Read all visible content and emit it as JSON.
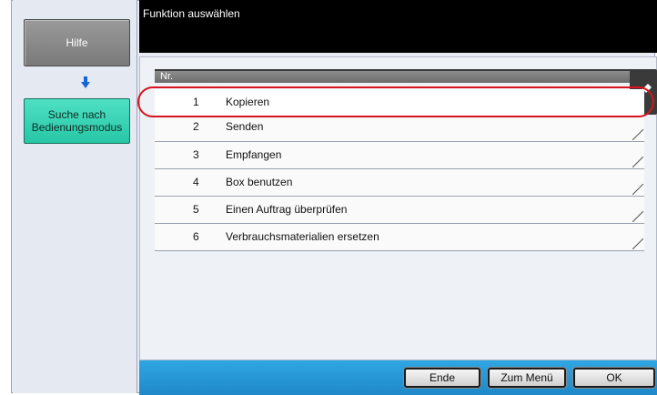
{
  "left": {
    "help_label": "Hilfe",
    "search_mode_label_line1": "Suche nach",
    "search_mode_label_line2": "Bedienungsmodus"
  },
  "header": {
    "title": "Funktion auswählen"
  },
  "table": {
    "header_label": "Nr.",
    "rows": [
      {
        "num": "1",
        "label": "Kopieren"
      },
      {
        "num": "2",
        "label": "Senden"
      },
      {
        "num": "3",
        "label": "Empfangen"
      },
      {
        "num": "4",
        "label": "Box benutzen"
      },
      {
        "num": "5",
        "label": "Einen Auftrag überprüfen"
      },
      {
        "num": "6",
        "label": "Verbrauchsmaterialien ersetzen"
      }
    ]
  },
  "footer": {
    "end_label": "Ende",
    "menu_label": "Zum Menü",
    "ok_label": "OK"
  },
  "colors": {
    "accent_green": "#27c7a6",
    "highlight_red": "#d8141e",
    "footer_blue": "#1f88c9",
    "arrow_blue": "#1565d8"
  },
  "icons": {
    "down_arrow": "arrow-down-icon",
    "scroll_handle": "scroll-handle-icon"
  }
}
